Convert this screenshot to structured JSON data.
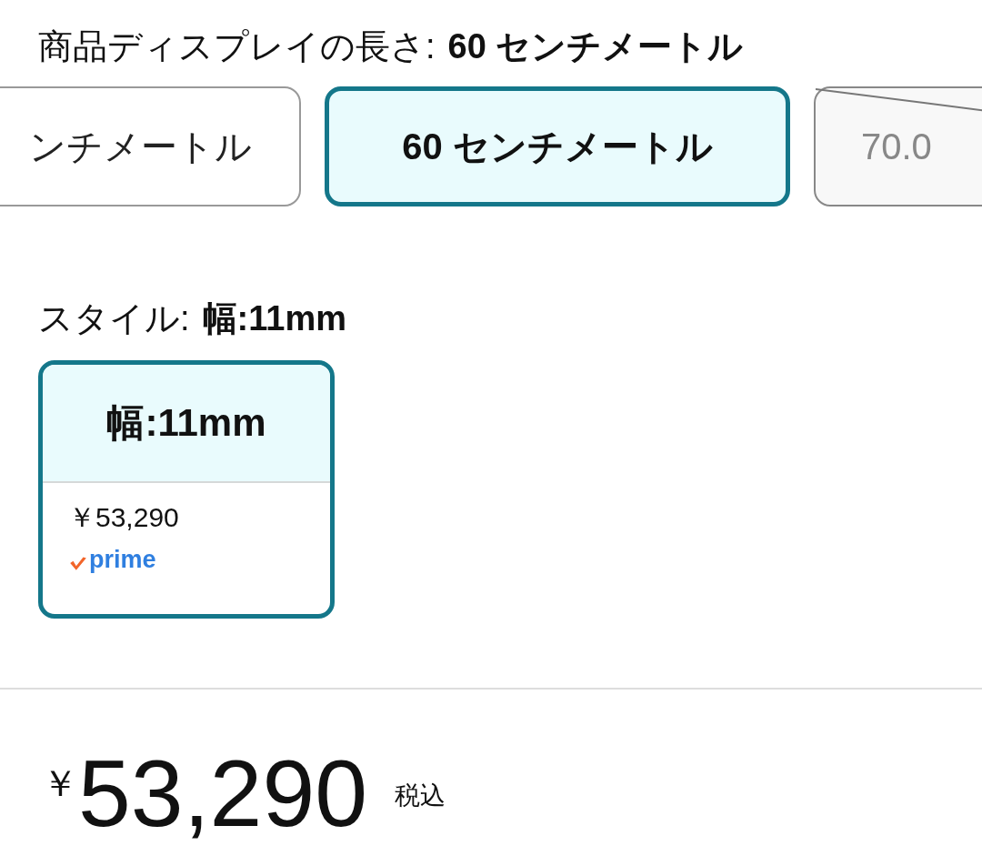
{
  "display_length": {
    "label": "商品ディスプレイの長さ:",
    "value": "60 センチメートル",
    "options": [
      {
        "label": "ンチメートル",
        "selected": false,
        "available": true
      },
      {
        "label": "60 センチメートル",
        "selected": true,
        "available": true
      },
      {
        "label": "70.0",
        "selected": false,
        "available": false
      }
    ]
  },
  "style": {
    "label": "スタイル:",
    "value": "幅:11mm",
    "options": [
      {
        "title": "幅:11mm",
        "price": "￥53,290",
        "prime": "prime",
        "selected": true
      }
    ]
  },
  "price": {
    "currency": "￥",
    "amount": "53,290",
    "tax_note": "税込"
  }
}
